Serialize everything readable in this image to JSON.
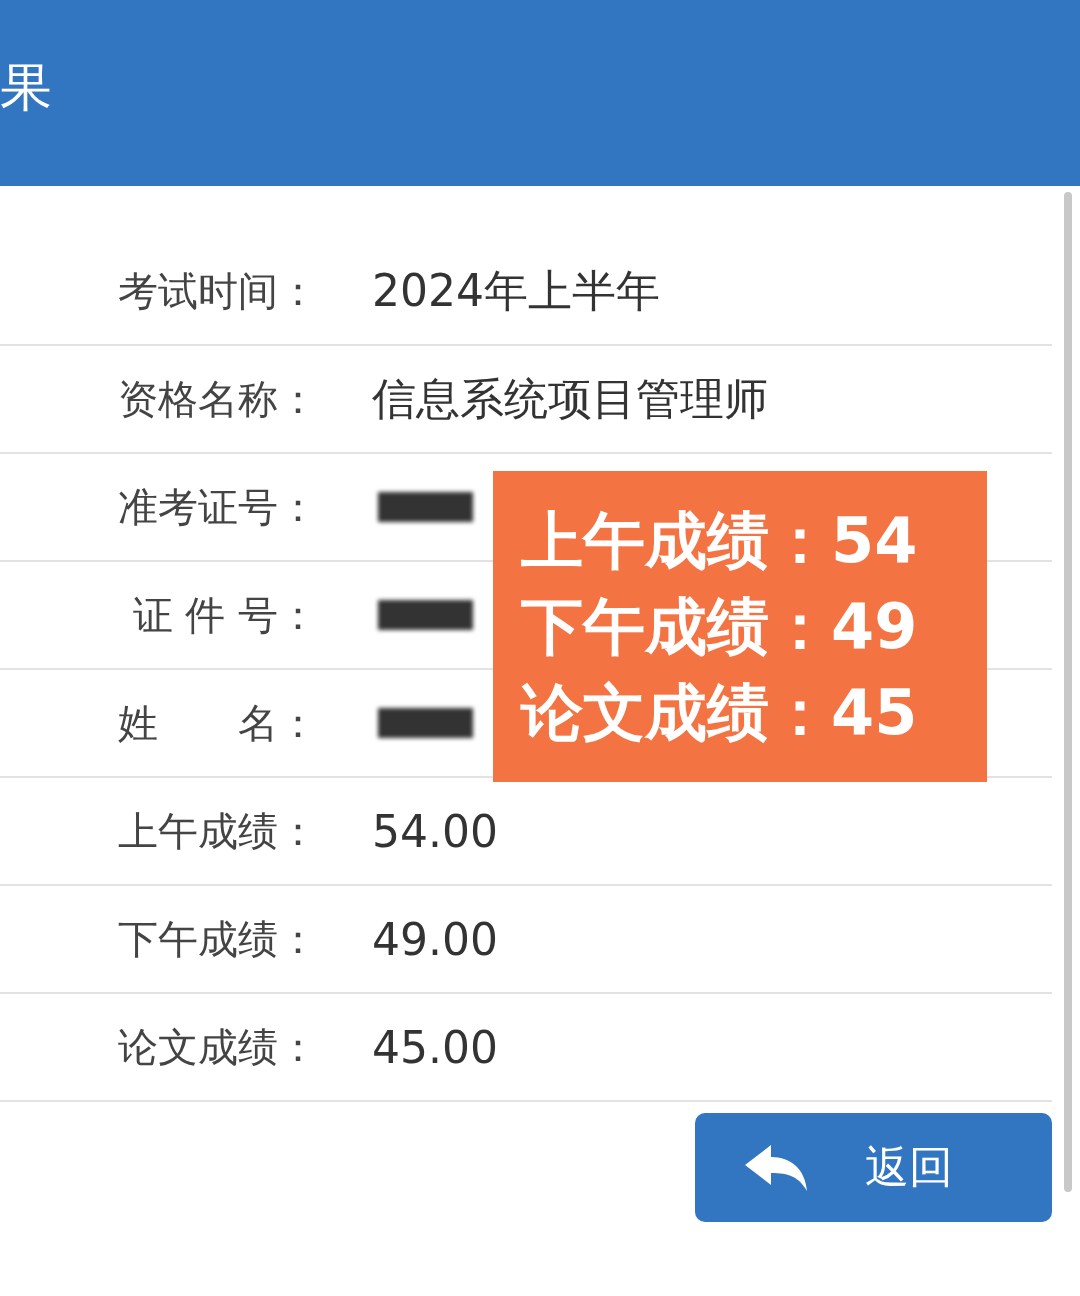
{
  "header": {
    "title": "果"
  },
  "rows": [
    {
      "kind": "text",
      "label": "考试时间：",
      "value": "2024年上半年"
    },
    {
      "kind": "text",
      "label": "资格名称：",
      "value": "信息系统项目管理师"
    },
    {
      "kind": "redacted",
      "label": "准考证号："
    },
    {
      "kind": "redacted",
      "label": "证 件 号："
    },
    {
      "kind": "redacted",
      "label": "姓　　名："
    },
    {
      "kind": "text",
      "label": "上午成绩：",
      "value": "54.00"
    },
    {
      "kind": "text",
      "label": "下午成绩：",
      "value": "49.00"
    },
    {
      "kind": "text",
      "label": "论文成绩：",
      "value": "45.00"
    }
  ],
  "overlay": {
    "lines": [
      "上午成绩：54",
      "下午成绩：49",
      "论文成绩：45"
    ]
  },
  "back_button": {
    "label": "返回"
  }
}
